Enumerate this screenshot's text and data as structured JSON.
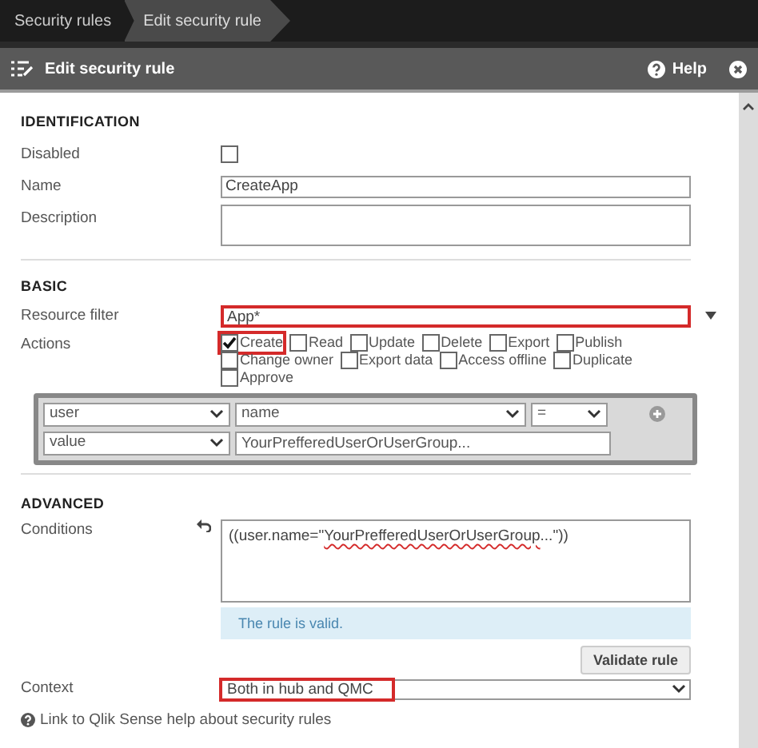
{
  "breadcrumbs": [
    {
      "label": "Security rules",
      "selected": false
    },
    {
      "label": "Edit security rule",
      "selected": true
    }
  ],
  "header": {
    "title": "Edit security rule",
    "help": "Help"
  },
  "identification": {
    "title": "IDENTIFICATION",
    "disabled_label": "Disabled",
    "disabled": false,
    "name_label": "Name",
    "name": "CreateApp",
    "description_label": "Description"
  },
  "basic": {
    "title": "BASIC",
    "resource_filter_label": "Resource filter",
    "resource_filter": "App*",
    "resource_filter_highlighted": true,
    "actions_label": "Actions",
    "actions": [
      {
        "label": "Create",
        "checked": true,
        "highlighted": true
      },
      {
        "label": "Read",
        "checked": false,
        "highlighted": false
      },
      {
        "label": "Update",
        "checked": false,
        "highlighted": false
      },
      {
        "label": "Delete",
        "checked": false,
        "highlighted": false
      },
      {
        "label": "Export",
        "checked": false,
        "highlighted": false
      },
      {
        "label": "Publish",
        "checked": false,
        "highlighted": false
      },
      {
        "label": "Change owner",
        "checked": false,
        "highlighted": false
      },
      {
        "label": "Export data",
        "checked": false,
        "highlighted": false
      },
      {
        "label": "Access offline",
        "checked": false,
        "highlighted": false
      },
      {
        "label": "Duplicate",
        "checked": false,
        "highlighted": false
      },
      {
        "label": "Approve",
        "checked": false,
        "highlighted": false
      }
    ],
    "builder": {
      "resource": "user",
      "property": "name",
      "operator": "=",
      "value_type": "value",
      "value": "YourPrefferedUserOrUserGroup..."
    }
  },
  "advanced": {
    "title": "ADVANCED",
    "conditions_label": "Conditions",
    "conditions_prefix": "((user.name=\"",
    "conditions_misspelled": "YourPrefferedUserOrUserGroup",
    "conditions_suffix": "...\"))",
    "validation": "The rule is valid.",
    "validate_button": "Validate rule",
    "context_label": "Context",
    "context": "Both in hub and QMC",
    "context_highlighted": true
  },
  "help_link": "Link to Qlik Sense help about security rules"
}
